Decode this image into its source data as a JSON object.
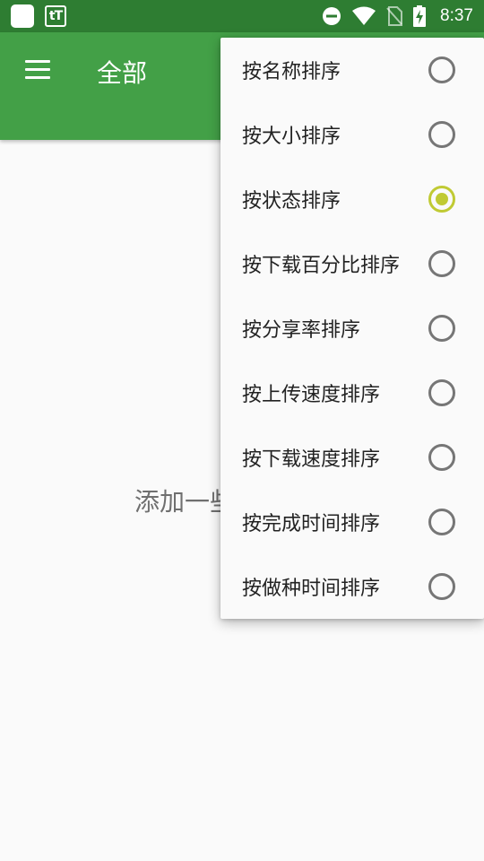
{
  "status_bar": {
    "time": "8:37",
    "icons": [
      "notification-square-icon",
      "tt-app-icon",
      "do-not-disturb-icon",
      "wifi-icon",
      "no-sim-icon",
      "battery-charging-icon"
    ],
    "tt_label": "tT"
  },
  "app_bar": {
    "title": "全部",
    "background": "#43a047",
    "status_background": "#2e7d32"
  },
  "main": {
    "empty_text": "添加一些"
  },
  "sort_menu": {
    "accent": "#c0ca33",
    "items": [
      {
        "label": "按名称排序",
        "checked": false
      },
      {
        "label": "按大小排序",
        "checked": false
      },
      {
        "label": "按状态排序",
        "checked": true
      },
      {
        "label": "按下载百分比排序",
        "checked": false
      },
      {
        "label": "按分享率排序",
        "checked": false
      },
      {
        "label": "按上传速度排序",
        "checked": false
      },
      {
        "label": "按下载速度排序",
        "checked": false
      },
      {
        "label": "按完成时间排序",
        "checked": false
      },
      {
        "label": "按做种时间排序",
        "checked": false
      }
    ]
  }
}
